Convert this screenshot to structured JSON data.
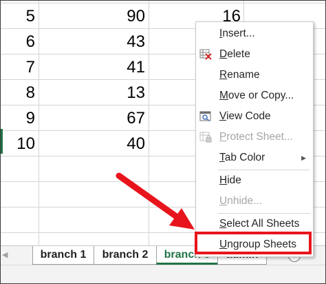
{
  "rows": [
    {
      "a": "5",
      "b": "90",
      "c": "16"
    },
    {
      "a": "6",
      "b": "43",
      "c": ""
    },
    {
      "a": "7",
      "b": "41",
      "c": ""
    },
    {
      "a": "8",
      "b": "13",
      "c": ""
    },
    {
      "a": "9",
      "b": "67",
      "c": ""
    },
    {
      "a": "10",
      "b": "40",
      "c": ""
    }
  ],
  "menu": {
    "insert": {
      "first": "I",
      "rest": "nsert..."
    },
    "delete": {
      "first": "D",
      "rest": "elete"
    },
    "rename": {
      "first": "R",
      "rest": "ename"
    },
    "move_copy": {
      "first": "M",
      "rest": "ove or Copy..."
    },
    "view_code": {
      "first": "V",
      "rest": "iew Code"
    },
    "protect_sheet": {
      "first": "P",
      "rest": "rotect Sheet..."
    },
    "tab_color": {
      "first": "T",
      "rest": "ab Color"
    },
    "hide": {
      "first": "H",
      "rest": "ide"
    },
    "unhide": {
      "first": "U",
      "rest": "nhide..."
    },
    "select_all": {
      "first": "S",
      "rest": "elect All Sheets"
    },
    "ungroup": {
      "first": "U",
      "rest": "ngroup Sheets"
    }
  },
  "tabs": [
    "branch 1",
    "branch 2",
    "branch 3",
    "admin"
  ],
  "add_sheet_symbol": "+",
  "colors": {
    "active_tab": "#217346",
    "highlight": "#e8141c",
    "arrow": "#e8141c"
  },
  "icons": {
    "delete": "delete-sheet-icon",
    "view_code": "view-code-icon",
    "protect_sheet": "protect-sheet-icon",
    "add_sheet": "plus-circle-icon",
    "submenu": "chevron-right-icon"
  }
}
